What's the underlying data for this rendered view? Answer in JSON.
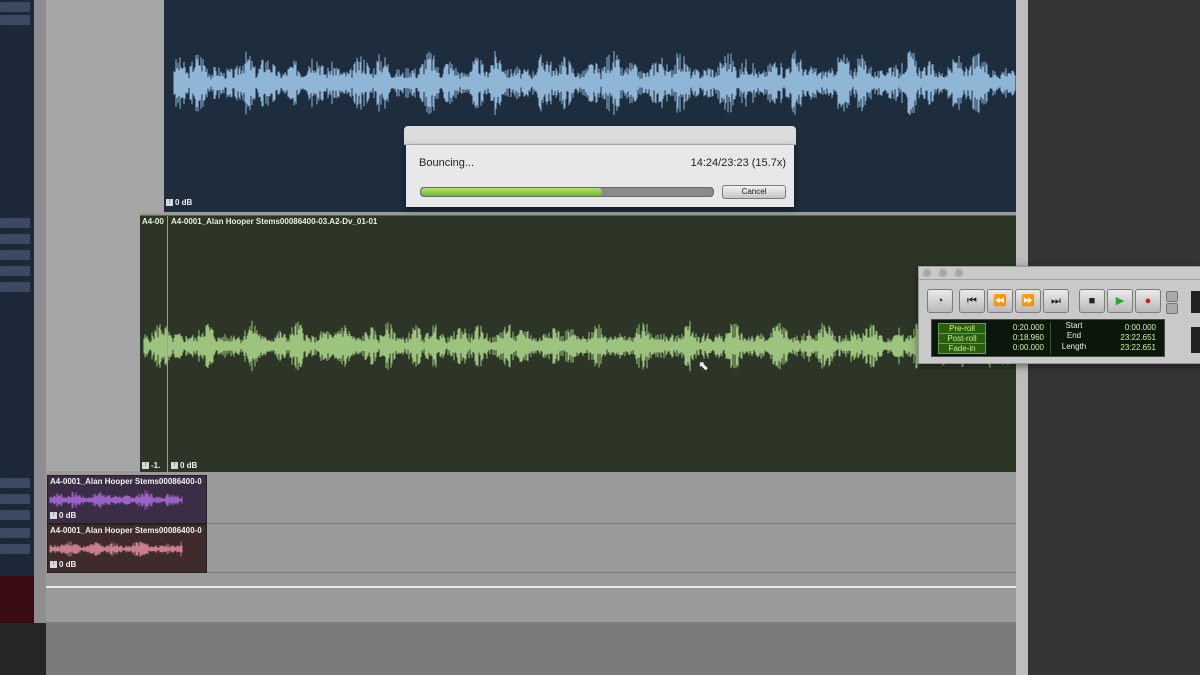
{
  "bounce_dialog": {
    "status": "Bouncing...",
    "time": "14:24/23:23 (15.7x)",
    "progress": 0.62,
    "cancel_label": "Cancel"
  },
  "tracks": {
    "track1": {
      "gain": "0 dB",
      "color": "#8fb6d6"
    },
    "track2": {
      "region_short": "A4-00",
      "region_name": "A4-0001_Alan Hooper Stems00086400-03.A2-Dv_01-01",
      "left_gain": "-1.",
      "gain": "0 dB",
      "color": "#9cc47f"
    },
    "clip_purple": {
      "name": "A4-0001_Alan Hooper Stems00086400-0",
      "gain": "0 dB",
      "color": "#9a62c4"
    },
    "clip_red": {
      "name": "A4-0001_Alan Hooper Stems00086400-0",
      "gain": "0 dB",
      "color": "#c77f8b"
    }
  },
  "transport": {
    "counter": {
      "preroll": {
        "label": "Pre-roll",
        "value": "0:20.000"
      },
      "postroll": {
        "label": "Post-roll",
        "value": "0:18.960"
      },
      "fadein": {
        "label": "Fade-in",
        "value": "0:00.000"
      },
      "start": {
        "label": "Start",
        "value": "0:00.000"
      },
      "end": {
        "label": "End",
        "value": "23:22.651"
      },
      "length": {
        "label": "Length",
        "value": "23:22.651"
      }
    }
  }
}
